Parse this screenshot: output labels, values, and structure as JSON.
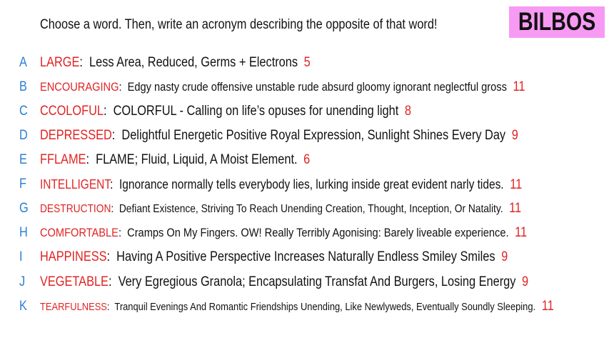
{
  "prompt": "Choose a word. Then, write an acronym describing the opposite of that word!",
  "badge": "BILBOS",
  "colors": {
    "letter": "#2b7fd3",
    "word": "#e02424",
    "count": "#e02424",
    "badge_bg": "#f79af3"
  },
  "rows": [
    {
      "letter": "A",
      "word": "LARGE",
      "acronym": "Less Area, Reduced, Germs + Electrons",
      "count": "5"
    },
    {
      "letter": "B",
      "word": "ENCOURAGING",
      "acronym": "Edgy nasty crude offensive unstable rude absurd gloomy ignorant neglectful gross",
      "count": "11"
    },
    {
      "letter": "C",
      "word": "CCOLOFUL",
      "acronym": "COLORFUL - Calling on life’s opuses for unending light",
      "count": "8"
    },
    {
      "letter": "D",
      "word": "DEPRESSED",
      "acronym": "Delightful Energetic Positive Royal Expression, Sunlight Shines Every Day",
      "count": "9"
    },
    {
      "letter": "E",
      "word": "FFLAME",
      "acronym": "FLAME; Fluid, Liquid, A Moist Element.",
      "count": "6"
    },
    {
      "letter": "F",
      "word": "INTELLIGENT",
      "acronym": "Ignorance normally tells everybody lies, lurking inside great evident narly tides.",
      "count": "11"
    },
    {
      "letter": "G",
      "word": "DESTRUCTION",
      "acronym": "Defiant Existence, Striving To Reach Unending Creation, Thought, Inception, Or Natality.",
      "count": "11"
    },
    {
      "letter": "H",
      "word": "COMFORTABLE",
      "acronym": "Cramps On My Fingers. OW! Really Terribly Agonising: Barely liveable experience.",
      "count": "11"
    },
    {
      "letter": "I",
      "word": "HAPPINESS",
      "acronym": "Having A Positive Perspective Increases Naturally Endless Smiley Smiles",
      "count": "9"
    },
    {
      "letter": "J",
      "word": "VEGETABLE",
      "acronym": "Very Egregious Granola; Encapsulating Transfat And Burgers, Losing Energy",
      "count": "9"
    },
    {
      "letter": "K",
      "word": "TEARFULNESS",
      "acronym": "Tranquil Evenings And Romantic Friendships Unending, Like Newlyweds, Eventually Soundly Sleeping.",
      "count": "11"
    }
  ]
}
